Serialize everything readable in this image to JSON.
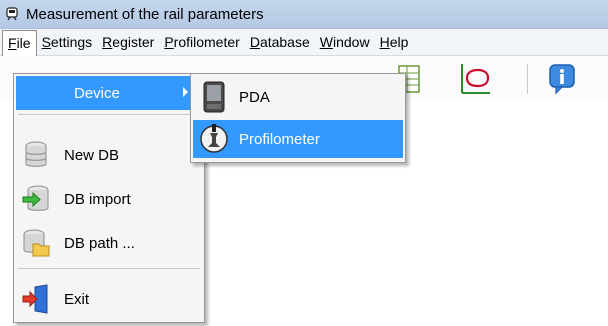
{
  "window": {
    "title": "Measurement of the rail parameters",
    "app_icon": "train-icon"
  },
  "menubar": {
    "items": [
      {
        "label_underline": "F",
        "label_rest": "ile",
        "open": true
      },
      {
        "label_underline": "S",
        "label_rest": "ettings"
      },
      {
        "label_underline": "R",
        "label_rest": "egister"
      },
      {
        "label_underline": "P",
        "label_rest": "rofilometer"
      },
      {
        "label_underline": "D",
        "label_rest": "atabase"
      },
      {
        "label_underline": "W",
        "label_rest": "indow"
      },
      {
        "label_underline": "H",
        "label_rest": "elp"
      }
    ]
  },
  "toolbar": {
    "icons": [
      "table-icon",
      "rail-profile-icon",
      "info-icon"
    ]
  },
  "file_menu": {
    "items": [
      {
        "label": "Device",
        "icon": "none",
        "highlighted": true,
        "has_submenu": true
      },
      {
        "label": "New DB",
        "icon": "database-icon"
      },
      {
        "label": "DB import",
        "icon": "database-import-icon"
      },
      {
        "label": "DB path ...",
        "icon": "database-folder-icon"
      },
      {
        "label": "Exit",
        "icon": "exit-icon"
      }
    ]
  },
  "device_submenu": {
    "items": [
      {
        "label": "PDA",
        "icon": "pda-icon"
      },
      {
        "label": "Profilometer",
        "icon": "profilometer-icon",
        "highlighted": true
      }
    ]
  },
  "colors": {
    "highlight": "#3399ff",
    "menu_bg": "#f5f5f5",
    "titlebar": "#c4d6ec"
  }
}
